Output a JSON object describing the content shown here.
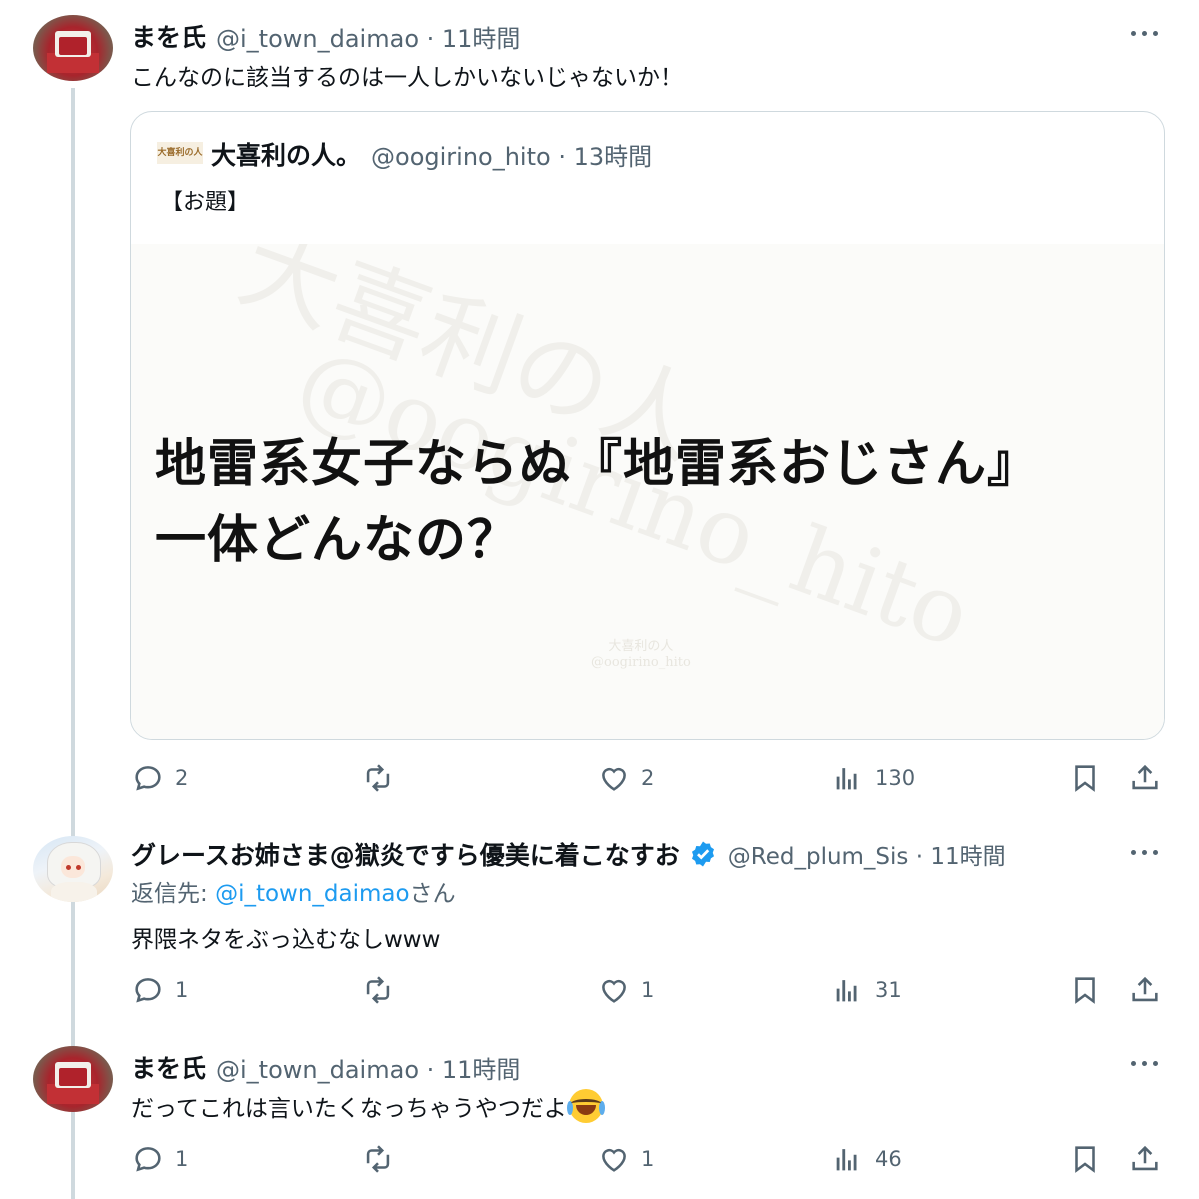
{
  "tweets": [
    {
      "name": "まを氏",
      "handle": "@i_town_daimao · 11時間",
      "text": "こんなのに該当するのは一人しかいないじゃないか！",
      "stats": {
        "replies": "2",
        "retweets": "",
        "likes": "2",
        "views": "130"
      }
    },
    {
      "name": "グレースお姉さま@獄炎ですら優美に着こなすお",
      "handle": "@Red_plum_Sis · 11時間",
      "reply_prefix": "返信先: ",
      "reply_link": "@i_town_daimao",
      "reply_suffix": "さん",
      "text": "界隈ネタをぶっ込むなしwww",
      "stats": {
        "replies": "1",
        "retweets": "",
        "likes": "1",
        "views": "31"
      }
    },
    {
      "name": "まを氏",
      "handle": "@i_town_daimao · 11時間",
      "text": "だってこれは言いたくなっちゃうやつだよ",
      "stats": {
        "replies": "1",
        "retweets": "",
        "likes": "1",
        "views": "46"
      }
    }
  ],
  "quote": {
    "logo_text": "大喜利の人",
    "name": "大喜利の人。",
    "handle": "@oogirino_hito · 13時間",
    "topic": "【お題】",
    "image": {
      "headline_line1": "地雷系女子ならぬ『地雷系おじさん』",
      "headline_line2": "一体どんなの？",
      "watermark_line1": "大喜利の人。",
      "watermark_line2": "@oogirino_hito",
      "small_mark_line1": "大喜利の人",
      "small_mark_line2": "@oogirino_hito"
    }
  },
  "icons": [
    "reply-icon",
    "retweet-icon",
    "like-icon",
    "views-icon",
    "bookmark-icon",
    "share-icon",
    "more-icon",
    "verified-badge-icon",
    "tears-of-joy-emoji"
  ],
  "colors": {
    "accent": "#1d9bf0",
    "secondary_text": "#536471",
    "border": "#cfd9de"
  }
}
